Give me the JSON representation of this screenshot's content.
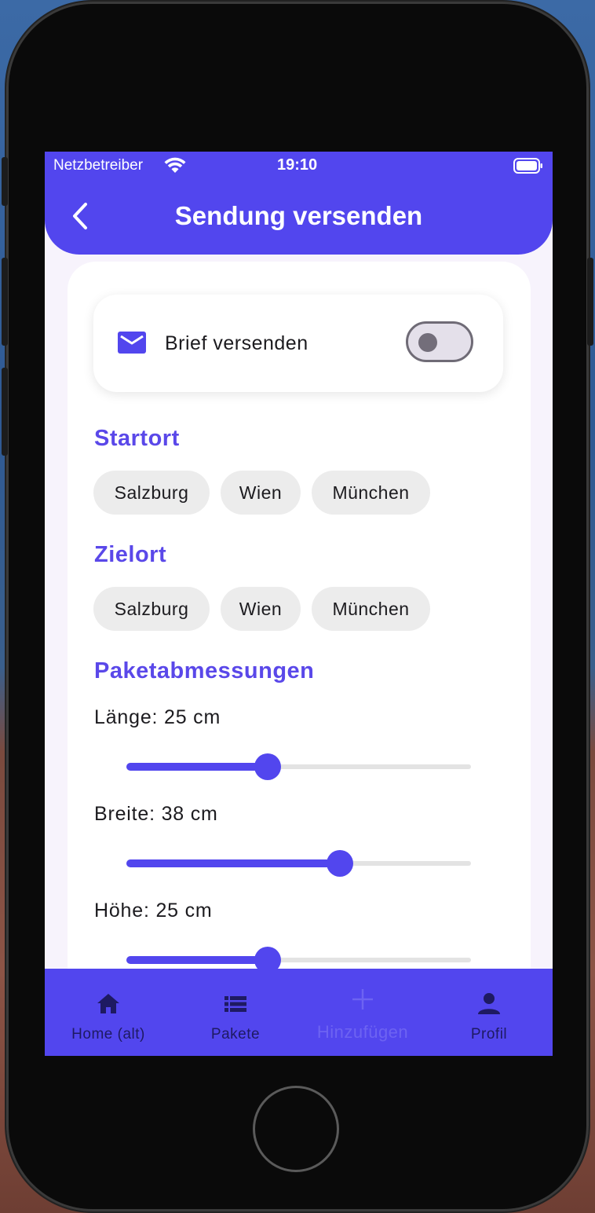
{
  "status_bar": {
    "carrier": "Netzbetreiber",
    "time": "19:10"
  },
  "app_bar": {
    "title": "Sendung versenden"
  },
  "brief": {
    "label": "Brief versenden",
    "toggle_on": false
  },
  "startort": {
    "title": "Startort",
    "chips": [
      "Salzburg",
      "Wien",
      "München"
    ]
  },
  "zielort": {
    "title": "Zielort",
    "chips": [
      "Salzburg",
      "Wien",
      "München"
    ]
  },
  "paket": {
    "title": "Paketabmessungen",
    "laenge": {
      "label": "Länge: 25 cm",
      "fraction": 0.41
    },
    "breite": {
      "label": "Breite: 38 cm",
      "fraction": 0.62
    },
    "hoehe": {
      "label": "Höhe: 25 cm",
      "fraction": 0.41
    }
  },
  "bottom_nav": {
    "items": [
      {
        "label": "Home (alt)",
        "icon": "home-icon"
      },
      {
        "label": "Pakete",
        "icon": "list-icon"
      },
      {
        "label": "Hinzufügen",
        "icon": "plus-icon"
      },
      {
        "label": "Profil",
        "icon": "person-icon"
      }
    ]
  },
  "colors": {
    "primary": "#5246ee",
    "section_title": "#5a48e9",
    "chip_bg": "#ececec"
  }
}
